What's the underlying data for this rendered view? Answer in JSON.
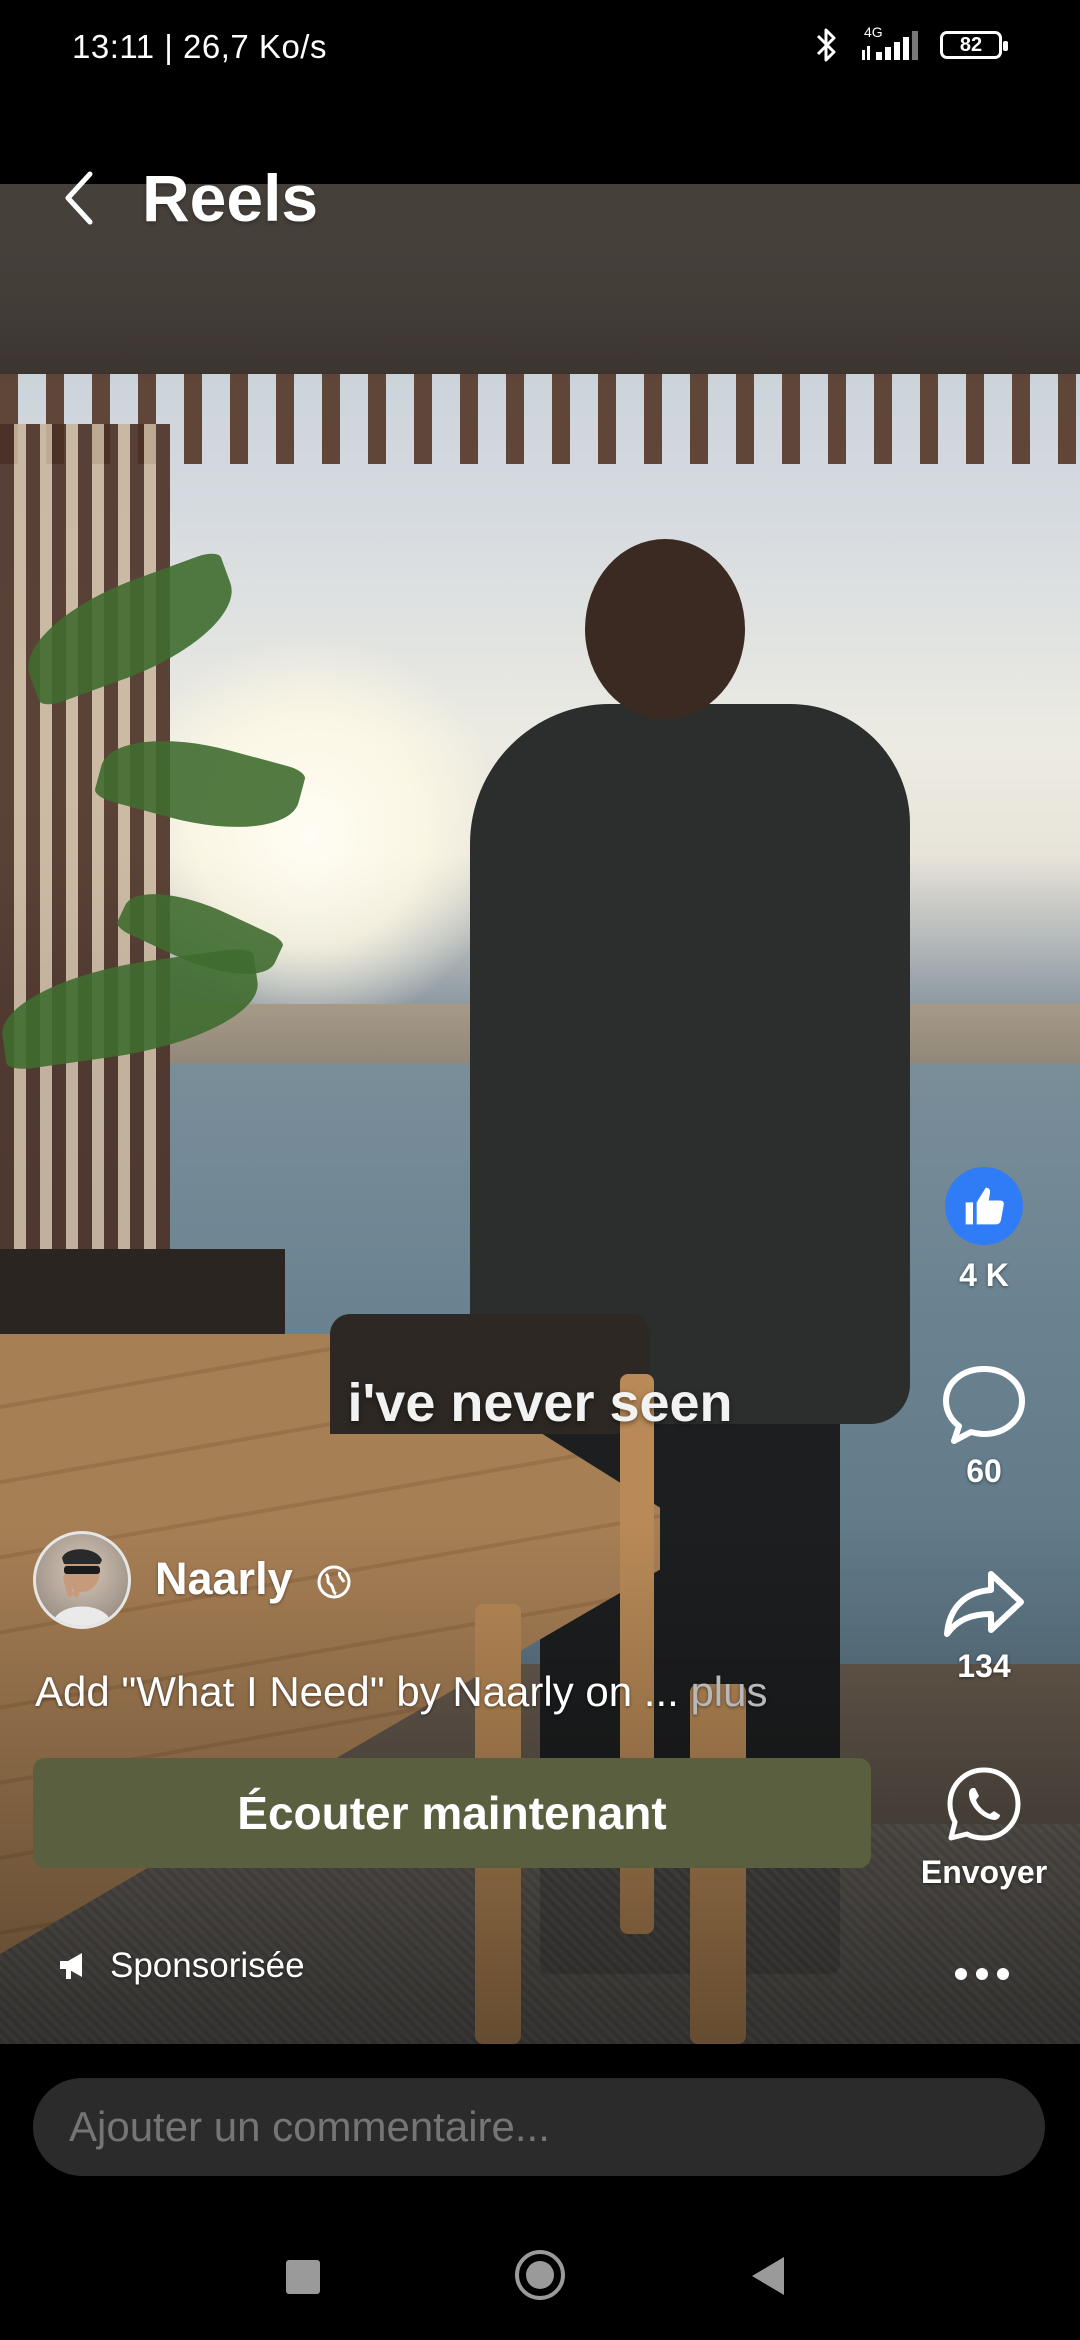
{
  "status_bar": {
    "time": "13:11 | 26,7 Ko/s",
    "network": "4G",
    "battery": "82"
  },
  "header": {
    "title": "Reels",
    "back_icon": "chevron-left-icon"
  },
  "video": {
    "caption_text": "i've never seen"
  },
  "actions": {
    "like": {
      "icon": "thumbs-up-icon",
      "count": "4 K",
      "color": "#2f7cf6"
    },
    "comment": {
      "icon": "comment-bubble-icon",
      "count": "60"
    },
    "share": {
      "icon": "share-arrow-icon",
      "count": "134"
    },
    "send": {
      "icon": "whatsapp-icon",
      "label": "Envoyer"
    },
    "more": {
      "icon": "more-dots-icon"
    }
  },
  "post": {
    "author": "Naarly",
    "privacy_icon": "globe-icon",
    "description": "Add \"What I Need\" by Naarly on ...",
    "more_label": " plus",
    "cta_label": "Écouter maintenant",
    "cta_color": "#5a5f40",
    "sponsored_label": "Sponsorisée",
    "sponsored_icon": "megaphone-icon"
  },
  "comment_bar": {
    "placeholder": "Ajouter un commentaire..."
  },
  "nav_bar": {
    "recents_icon": "square-icon",
    "home_icon": "circle-home-icon",
    "back_icon": "triangle-back-icon"
  }
}
